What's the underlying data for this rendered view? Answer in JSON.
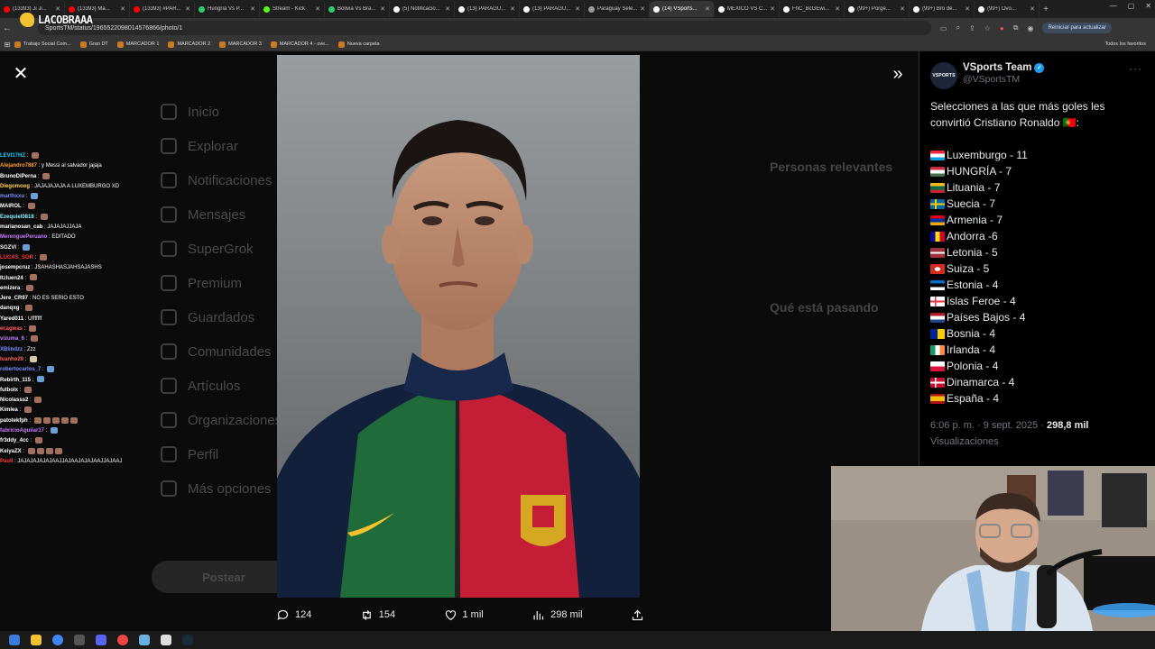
{
  "browser": {
    "tabs": [
      {
        "label": "(13393) Ji Ji...",
        "color": "#ff0000"
      },
      {
        "label": "(13393) Ma...",
        "color": "#ff0000"
      },
      {
        "label": "(13393) #PAR...",
        "color": "#ff0000"
      },
      {
        "label": "Hungría Vs P...",
        "color": "#2ecc71"
      },
      {
        "label": "Stream - Kick",
        "color": "#53fc18"
      },
      {
        "label": "Bolivia Vs Bra...",
        "color": "#2ecc71"
      },
      {
        "label": "(5) Notificacio...",
        "color": "#ffffff"
      },
      {
        "label": "(13) PARAGU...",
        "color": "#ffffff"
      },
      {
        "label": "(13) PARAGU...",
        "color": "#ffffff"
      },
      {
        "label": "Paraguay Sele...",
        "color": "#999999"
      },
      {
        "label": "(14) VSports...",
        "color": "#ffffff"
      },
      {
        "label": "MEXICO VS C...",
        "color": "#ffffff"
      },
      {
        "label": "FhC_BcGEwi...",
        "color": "#ffffff"
      },
      {
        "label": "(99+) Porge...",
        "color": "#ffffff"
      },
      {
        "label": "(99+) Bro de...",
        "color": "#ffffff"
      },
      {
        "label": "(99+) Ovo...",
        "color": "#ffffff"
      }
    ],
    "new_tab": "+",
    "url": "SportsTM/status/1965522098014576866/photo/1",
    "update_button": "Reiniciar para actualizar",
    "bookmarks": [
      "Trabajo Social Com...",
      "Gran DT",
      "MARCADOR 1",
      "MARCADOR 2",
      "MARCADOR 3",
      "MARCADOR 4 - ove...",
      "Nueva carpeta"
    ],
    "bookmarks_right": "Todos los favoritos"
  },
  "stream": {
    "logo_text": "LACOBRAAA"
  },
  "background_ui": {
    "nav": [
      "Inicio",
      "Explorar",
      "Notificaciones",
      "Mensajes",
      "SuperGrok",
      "Premium",
      "Guardados",
      "Comunidades",
      "Artículos",
      "Organizaciones",
      "Perfil",
      "Más opciones"
    ],
    "post_button": "Postear",
    "relevant_header": "Personas relevantes",
    "happening_header": "Qué está pasando"
  },
  "viewer": {
    "close_icon": "close-icon",
    "expand_icon": "double-chevron-right-icon"
  },
  "actions": {
    "replies": "124",
    "reposts": "154",
    "likes": "1 mil",
    "views": "298 mil"
  },
  "chat": [
    {
      "user": "LEVI17HZ",
      "color": "#00d5ff",
      "msg": "",
      "emote": "e"
    },
    {
      "user": "Alejandro7887",
      "color": "#ff9f2f",
      "msg": "y Messi al salvador jajaja",
      "emote": ""
    },
    {
      "user": "BrunoDiPerna",
      "color": "#ffffff",
      "msg": "",
      "emote": "e"
    },
    {
      "user": "Diegomoog",
      "color": "#ffd24a",
      "msg": "JAJAJAJAJA A LUXEMBURGO XD",
      "emote": ""
    },
    {
      "user": "marthxxu",
      "color": "#7a8dff",
      "msg": "",
      "emote": "b"
    },
    {
      "user": "MAIROL",
      "color": "#ffffff",
      "msg": "",
      "emote": "e"
    },
    {
      "user": "Ezequiel0818",
      "color": "#8cf0ff",
      "msg": "",
      "emote": "e"
    },
    {
      "user": "marianosan_cab",
      "color": "#ffffff",
      "msg": "JAJAJAJJAJA",
      "emote": ""
    },
    {
      "user": "MerenguePeruano",
      "color": "#c77dff",
      "msg": "EDITADO",
      "emote": ""
    },
    {
      "user": "SGZVI",
      "color": "#ffffff",
      "msg": "",
      "emote": "b"
    },
    {
      "user": "LUCAS_SGR",
      "color": "#ff3b3b",
      "msg": "",
      "emote": "e"
    },
    {
      "user": "josempcruz",
      "color": "#ffffff",
      "msg": "JSAHASHASJAHSAJASHS",
      "emote": ""
    },
    {
      "user": "Itzluen24",
      "color": "#ffffff",
      "msg": "",
      "emote": "e"
    },
    {
      "user": "emizera",
      "color": "#ffffff",
      "msg": "",
      "emote": "e"
    },
    {
      "user": "Jere_CR97",
      "color": "#ffffff",
      "msg": "NO ES SERIO ESTO",
      "emote": ""
    },
    {
      "user": "danqxg",
      "color": "#ffffff",
      "msg": "",
      "emote": "e"
    },
    {
      "user": "Yared011",
      "color": "#ffffff",
      "msg": "Ufffffff",
      "emote": ""
    },
    {
      "user": "ecagwas",
      "color": "#ff5e5e",
      "msg": "",
      "emote": "e"
    },
    {
      "user": "vizuma_6",
      "color": "#c77dff",
      "msg": "",
      "emote": "e"
    },
    {
      "user": "XBlindzz",
      "color": "#7a8dff",
      "msg": "Zzz",
      "emote": ""
    },
    {
      "user": "Ivanho29",
      "color": "#ff5e5e",
      "msg": "",
      "emote": "l"
    },
    {
      "user": "robertocarlos_7",
      "color": "#7a8dff",
      "msg": "",
      "emote": "b"
    },
    {
      "user": "Rebirth_115",
      "color": "#ffffff",
      "msg": "",
      "emote": "b"
    },
    {
      "user": "futbolx",
      "color": "#ffffff",
      "msg": "",
      "emote": "e"
    },
    {
      "user": "Nicolasss2",
      "color": "#ffffff",
      "msg": "",
      "emote": "e"
    },
    {
      "user": "Kimlea",
      "color": "#ffffff",
      "msg": "",
      "emote": "e"
    },
    {
      "user": "patotekfph",
      "color": "#ffffff",
      "msg": "",
      "emote": "eeeee"
    },
    {
      "user": "fabricioAguilar17",
      "color": "#c77dff",
      "msg": "",
      "emote": "b"
    },
    {
      "user": "fr3ddy_4cc",
      "color": "#ffffff",
      "msg": "",
      "emote": "e"
    },
    {
      "user": "KeiyaZX",
      "color": "#ffffff",
      "msg": "",
      "emote": "eeee"
    },
    {
      "user": "PaulI",
      "color": "#ff3b3b",
      "msg": "JAJAJAJAJAJAAJJAJAAJAJAJAAJJAJAAJ",
      "emote": ""
    }
  ],
  "tweet": {
    "display_name": "VSports Team",
    "handle": "@VSportsTM",
    "avatar_text": "VSPORTS",
    "intro": "Selecciones a las que más goles les convirtió Cristiano Ronaldo 🇵🇹:",
    "rows": [
      {
        "text": "Luxemburgo - 11",
        "flag": "lux"
      },
      {
        "text": "HUNGRÍA - 7",
        "flag": "hun"
      },
      {
        "text": "Lituania - 7",
        "flag": "ltu"
      },
      {
        "text": "Suecia - 7",
        "flag": "swe"
      },
      {
        "text": "Armenia - 7",
        "flag": "arm"
      },
      {
        "text": "Andorra -6",
        "flag": "and"
      },
      {
        "text": "Letonia - 5",
        "flag": "lva"
      },
      {
        "text": "Suiza - 5",
        "flag": "sui"
      },
      {
        "text": "Estonia - 4",
        "flag": "est"
      },
      {
        "text": "Islas Feroe - 4",
        "flag": "fro"
      },
      {
        "text": "Países Bajos - 4",
        "flag": "ned"
      },
      {
        "text": "Bosnia - 4",
        "flag": "bih"
      },
      {
        "text": "Irlanda - 4",
        "flag": "irl"
      },
      {
        "text": "Polonia - 4",
        "flag": "pol"
      },
      {
        "text": "Dinamarca - 4",
        "flag": "den"
      },
      {
        "text": "España - 4",
        "flag": "esp"
      }
    ],
    "time": "6:06 p. m. · 9 sept. 2025 · ",
    "views_count": "298,8 mil",
    "views_label": "Visualizaciones"
  }
}
